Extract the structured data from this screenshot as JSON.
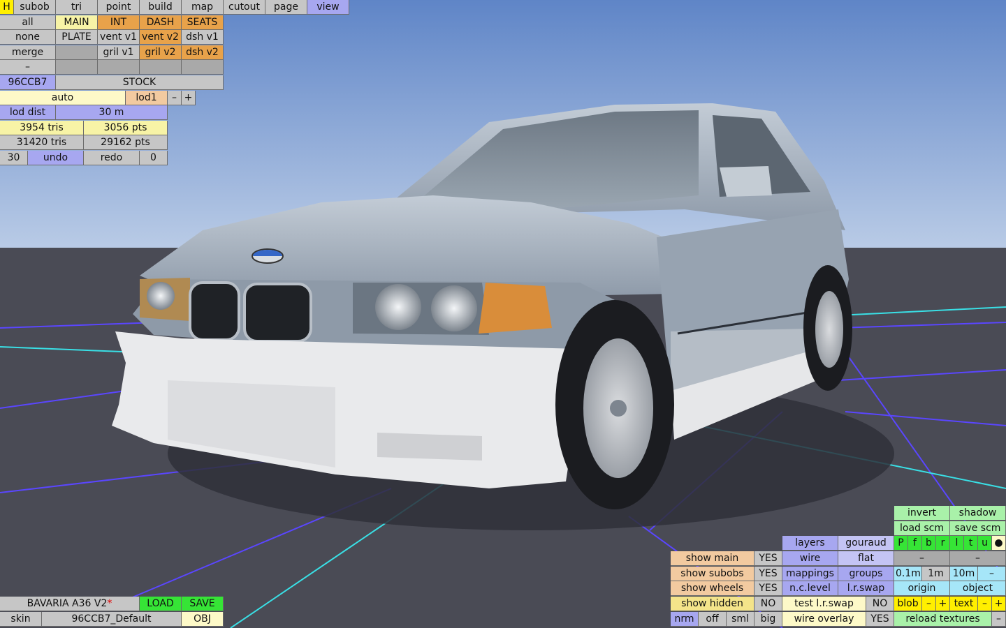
{
  "menu": {
    "tabs": [
      "H",
      "subob",
      "tri",
      "point",
      "build",
      "map",
      "cutout",
      "page",
      "view"
    ]
  },
  "subobjects": {
    "row1": [
      "all",
      "MAIN",
      "INT",
      "DASH",
      "SEATS"
    ],
    "row2": [
      "none",
      "PLATE",
      "vent v1",
      "vent v2",
      "dsh v1"
    ],
    "row3": [
      "merge",
      "",
      "gril v1",
      "gril v2",
      "dsh v2"
    ],
    "row4": [
      "–",
      "",
      "",
      "",
      ""
    ]
  },
  "color_code": "96CCB7",
  "variant": "STOCK",
  "lod": {
    "mode": "auto",
    "level": "lod1",
    "minus": "–",
    "plus": "+",
    "dist_label": "lod dist",
    "dist_value": "30 m"
  },
  "stats": {
    "tris_visible": "3954 tris",
    "pts_visible": "3056 pts",
    "tris_total": "31420 tris",
    "pts_total": "29162 pts"
  },
  "history": {
    "undo_count": "30",
    "undo": "undo",
    "redo": "redo",
    "redo_count": "0"
  },
  "model": {
    "name": "BAVARIA A36 V2",
    "modified_mark": "*",
    "load": "LOAD",
    "save": "SAVE",
    "skin_label": "skin",
    "skin_value": "96CCB7_Default",
    "obj": "OBJ"
  },
  "right_panel": {
    "invert": "invert",
    "shadow": "shadow",
    "load_scm": "load scm",
    "save_scm": "save scm",
    "layers": "layers",
    "gouraud": "gouraud",
    "layer_flags": [
      "P",
      "f",
      "b",
      "r",
      "l",
      "t",
      "u",
      "●"
    ],
    "wire": "wire",
    "flat": "flat",
    "dash1": "–",
    "dash2": "–",
    "mappings": "mappings",
    "groups": "groups",
    "grid_01": "0.1m",
    "grid_1": "1m",
    "grid_10": "10m",
    "grid_minus": "–",
    "nclevel": "n.c.level",
    "lrswap": "l.r.swap",
    "origin": "origin",
    "object": "object",
    "test_lrswap": "test l.r.swap",
    "test_lrswap_val": "NO",
    "blob": "blob",
    "blob_minus": "–",
    "blob_plus": "+",
    "text": "text",
    "text_minus": "–",
    "text_plus": "+",
    "wire_overlay": "wire overlay",
    "wire_overlay_val": "YES",
    "reload_textures": "reload textures",
    "reload_minus": "–"
  },
  "show_panel": {
    "show_main": "show main",
    "show_main_val": "YES",
    "show_subobs": "show subobs",
    "show_subobs_val": "YES",
    "show_wheels": "show wheels",
    "show_wheels_val": "YES",
    "show_hidden": "show hidden",
    "show_hidden_val": "NO",
    "nrm": "nrm",
    "off": "off",
    "sml": "sml",
    "big": "big"
  },
  "colors": {
    "sky": "#8fb3e1",
    "floor": "#4a4b55",
    "car_body": "#a9b4c1",
    "grid": "#5a46ff"
  }
}
